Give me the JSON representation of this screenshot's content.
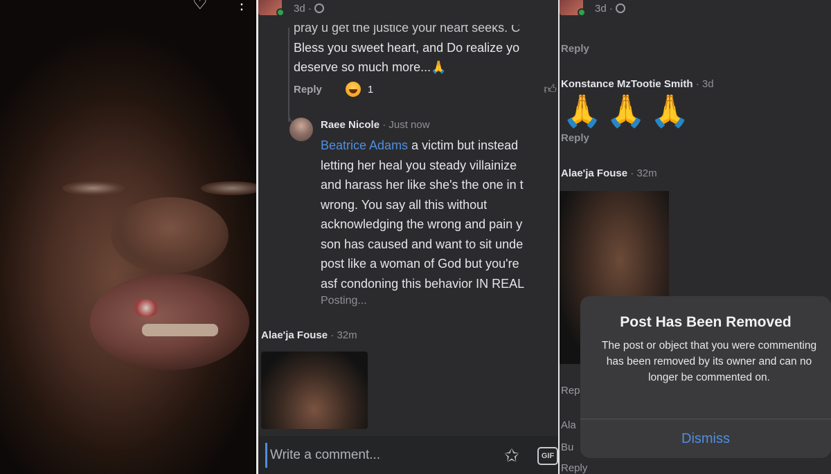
{
  "photo_panel": {
    "icons": [
      "heart-icon",
      "more-options-icon"
    ]
  },
  "comments_panel": {
    "header_time": "3d ·",
    "prev_comment": {
      "cut_line": "pray u get the justice your heart seeks. C",
      "line_1": "Bless you sweet heart, and Do realize yo",
      "line_2": "deserve so much more...🙏",
      "reply_label": "Reply",
      "reaction_count": "1"
    },
    "reply": {
      "author": "Raee Nicole",
      "time": " · Just now",
      "mention": "Beatrice Adams",
      "line_1_rest": " a victim but instead",
      "lines": [
        "letting her heal you steady villainize",
        "and harass her like she's the one in t",
        "wrong. You say all this without",
        "acknowledging the wrong and pain y",
        "son has caused and want to sit unde",
        "post like a woman of God but you're",
        "asf condoning this behavior IN REAL"
      ],
      "status": "Posting..."
    },
    "next_comment": {
      "author": "Alae'ja Fouse",
      "time": " · 32m"
    },
    "composer": {
      "placeholder": "Write a comment...",
      "gif_label": "GIF"
    }
  },
  "removed_panel": {
    "header_time": "3d ·",
    "reply_labels": [
      "Reply",
      "Reply"
    ],
    "comment_1": {
      "author": "Konstance MzTootie Smith",
      "time": " · 3d",
      "text": "🙏🙏🙏"
    },
    "comment_2": {
      "author": "Alae'ja Fouse",
      "time": " · 32m"
    },
    "fragments": [
      "Rep",
      "Ala",
      "Bu",
      "Reply"
    ],
    "modal": {
      "title": "Post Has Been Removed",
      "message": "The post or object that you were commenting has been removed by its owner and can no longer be commented on.",
      "button": "Dismiss"
    }
  }
}
